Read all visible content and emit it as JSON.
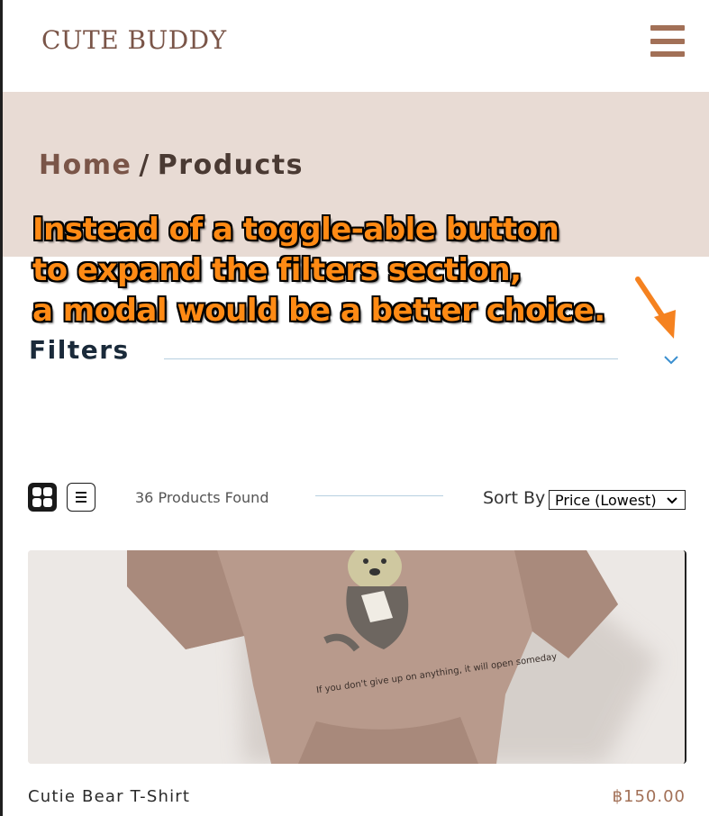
{
  "header": {
    "logo": "CUTE BUDDY",
    "menu_icon": "hamburger-menu-icon"
  },
  "breadcrumb": {
    "home": "Home",
    "separator": "/",
    "current": "Products"
  },
  "filters": {
    "title": "Filters",
    "toggle_icon": "chevron-down-icon"
  },
  "annotation": {
    "lines": [
      "Instead of a toggle-able button",
      "to expand the filters section,",
      "a modal would be a better choice."
    ]
  },
  "toolbar": {
    "grid_icon": "grid-view-icon",
    "list_icon": "list-view-icon",
    "count": "36 Products Found",
    "sort_label": "Sort By",
    "sort_value": "Price (Lowest)"
  },
  "products": [
    {
      "name": "Cutie Bear T-Shirt",
      "price": "฿150.00",
      "shirt_text": "If you don't give up on anything, it will open someday"
    }
  ],
  "colors": {
    "brand": "#7a5548",
    "accent": "#a27057",
    "hero_bg": "#e8dbd4",
    "annotation": "#ff8a14",
    "chevron": "#3a8fd0"
  }
}
